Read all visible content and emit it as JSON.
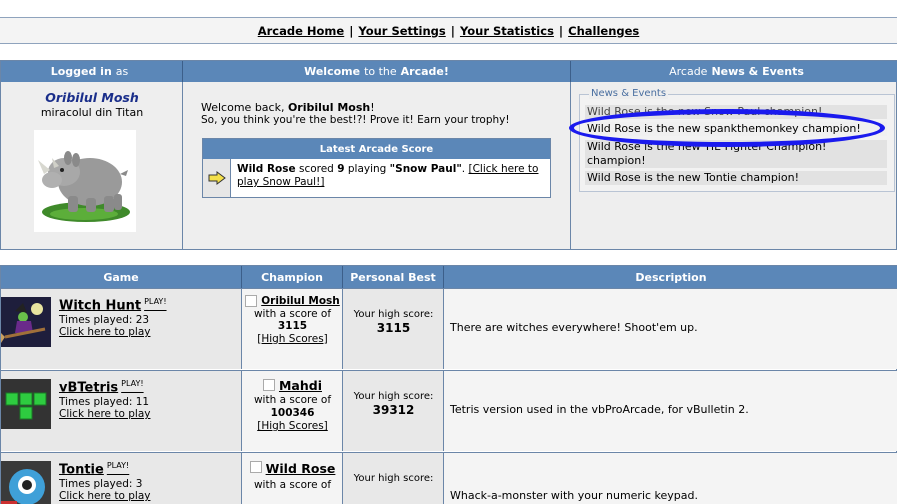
{
  "nav": {
    "links": [
      "Arcade Home",
      "Your Settings",
      "Your Statistics",
      "Challenges"
    ],
    "separator": "|"
  },
  "panels": {
    "logged_in": {
      "label_bold": "Logged in",
      "label_rest": "as"
    },
    "welcome_header": {
      "a": "Welcome",
      "b": "to the",
      "c": "Arcade!"
    },
    "news_header": {
      "a": "Arcade",
      "b": "News & Events"
    },
    "user": {
      "name": "Oribilul Mosh",
      "title": "miracolul din Titan",
      "avatar": "rhino-avatar"
    },
    "welcome_back": {
      "prefix": "Welcome back,",
      "name": "Oribilul Mosh",
      "suffix": "!"
    },
    "tagline": "So, you think you're the best!?! Prove it! Earn your trophy!",
    "latest": {
      "title": "Latest Arcade Score",
      "player": "Wild Rose",
      "scored": "scored",
      "score": "9",
      "playing": "playing",
      "game": "\"Snow Paul\"",
      "link": "[Click here to play Snow Paul!]"
    },
    "news": {
      "legend": "News & Events",
      "items": [
        "Wild Rose is the new Snow Paul champion!",
        "Wild Rose is the new spankthemonkey champion!",
        "Wild Rose is the new TIE Fighter Champion! champion!",
        "Wild Rose is the new Tontie champion!"
      ]
    }
  },
  "games": {
    "headers": [
      "Game",
      "Champion",
      "Personal Best",
      "Description"
    ],
    "play_tag": "PLAY!",
    "times_label": "Times played:",
    "click_label": "Click here to play",
    "with_score": "with a score of",
    "high_scores": "[High Scores]",
    "your_high": "Your high score:",
    "rows": [
      {
        "name": "Witch Hunt",
        "times": "23",
        "champion": "Oribilul Mosh",
        "score": "3115",
        "best": "3115",
        "desc": "There are witches everywhere! Shoot'em up."
      },
      {
        "name": "vBTetris",
        "times": "11",
        "champion": "Mahdi",
        "score": "100346",
        "best": "39312",
        "desc": "Tetris version used in the vbProArcade, for vBulletin 2."
      },
      {
        "name": "Tontie",
        "times": "3",
        "champion": "Wild Rose",
        "score": "",
        "best": "",
        "desc": "Whack-a-monster with your numeric keypad."
      }
    ]
  },
  "colors": {
    "header_blue": "#5b87b8",
    "champion_name": "#1a2e8a",
    "circle": "#1a1aee"
  }
}
